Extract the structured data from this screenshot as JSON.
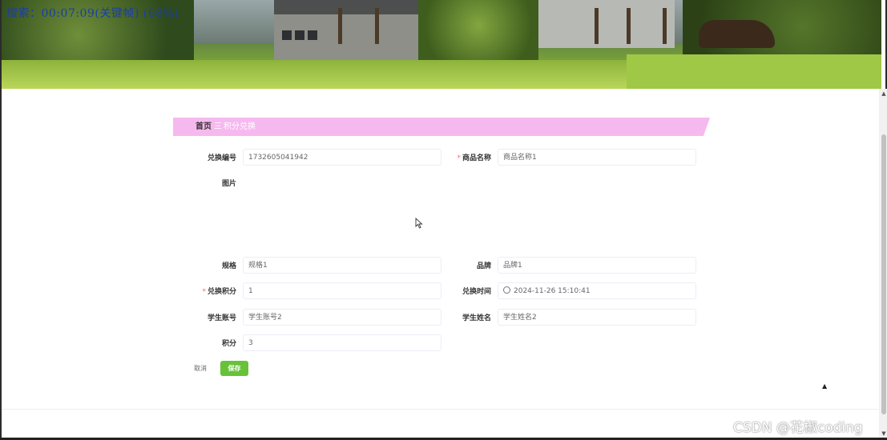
{
  "banner": {
    "overlay_text": "搜索：00:07:09(关键帧) (68%)"
  },
  "breadcrumb": {
    "home": "首页",
    "separator": "三",
    "current": "积分兑换"
  },
  "form": {
    "exchange_no": {
      "label": "兑换编号",
      "value": "1732605041942"
    },
    "product_name": {
      "label": "商品名称",
      "value": "商品名称1",
      "required": true
    },
    "image": {
      "label": "图片"
    },
    "spec": {
      "label": "规格",
      "value": "规格1"
    },
    "brand": {
      "label": "品牌",
      "value": "品牌1"
    },
    "points": {
      "label": "兑换积分",
      "value": "1",
      "required": true
    },
    "exchange_time": {
      "label": "兑换时间",
      "value": "2024-11-26 15:10:41"
    },
    "student_account": {
      "label": "学生账号",
      "value": "学生账号2"
    },
    "student_name": {
      "label": "学生姓名",
      "value": "学生姓名2"
    },
    "balance": {
      "label": "积分",
      "value": "3"
    }
  },
  "actions": {
    "cancel": "取消",
    "save": "保存"
  },
  "watermark": "CSDN @花椒coding",
  "colors": {
    "breadcrumb_bg": "#f6b9ef",
    "save_button": "#67c23a",
    "required_star": "#f56c6c"
  }
}
